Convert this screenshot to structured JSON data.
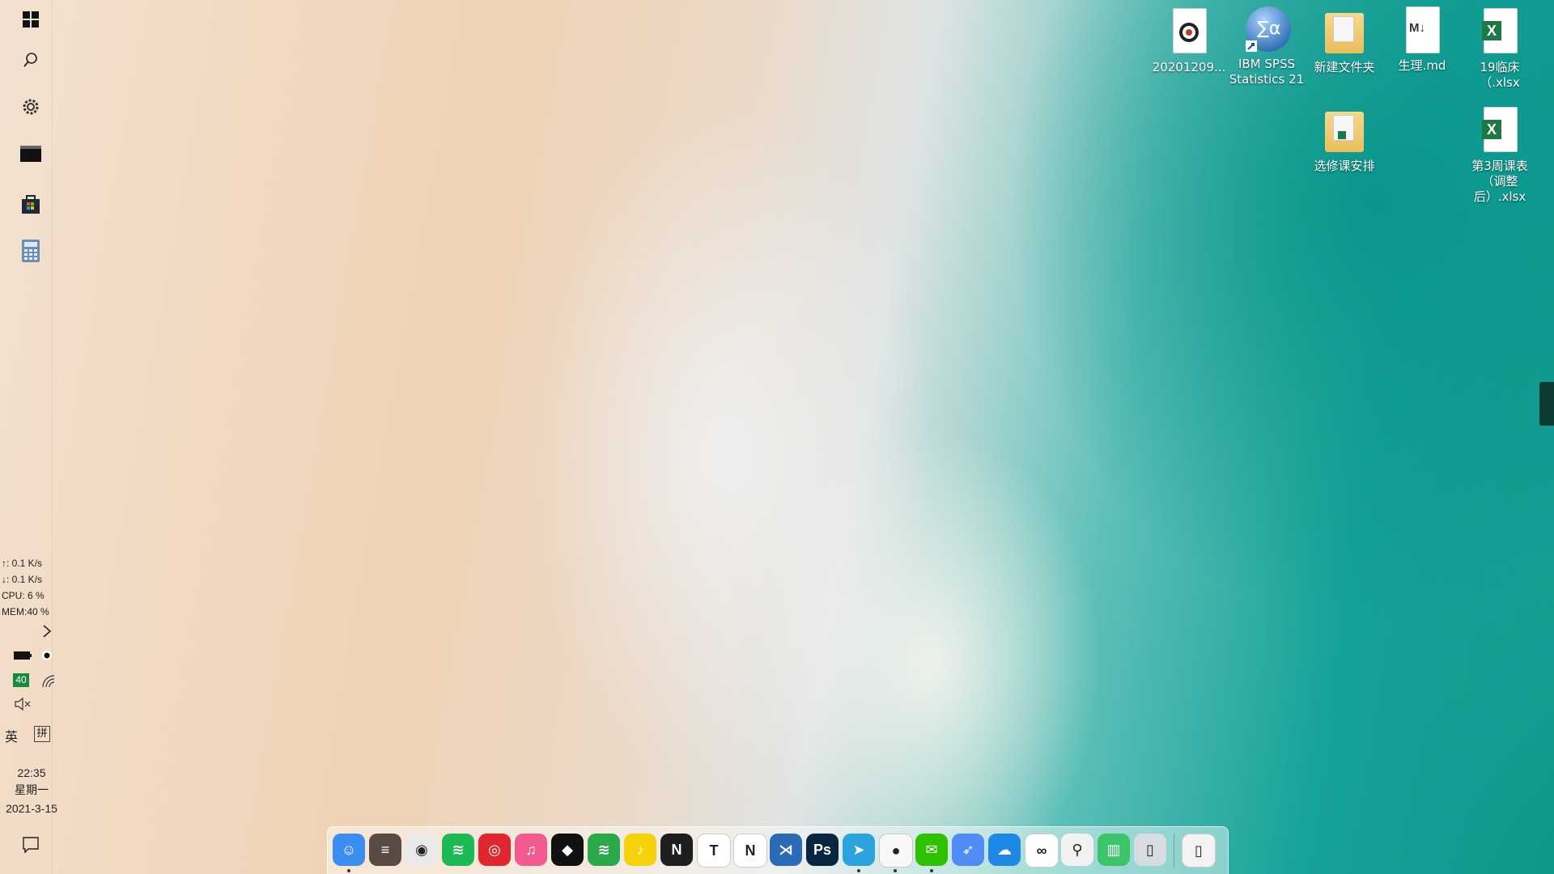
{
  "left_bar": {
    "net_up": "↑: 0.1 K/s",
    "net_down": "↓: 0.1 K/s",
    "cpu": "CPU: 6 %",
    "mem": "MEM:40 %",
    "battery_badge": "40",
    "ime_lang": "英",
    "ime_mode": "拼",
    "time": "22:35",
    "weekday": "星期一",
    "date": "2021-3-15"
  },
  "desktop_icons": [
    {
      "label": "20201209...",
      "icon": "audio-file-icon"
    },
    {
      "label": "IBM SPSS Statistics 21",
      "icon": "spss-icon"
    },
    {
      "label": "新建文件夹",
      "icon": "folder-icon"
    },
    {
      "label": "生理.md",
      "icon": "markdown-file-icon"
    },
    {
      "label": "19临床（.xlsx",
      "icon": "excel-file-icon"
    },
    {
      "label": "选修课安排",
      "icon": "folder-icon"
    },
    {
      "label": "第3周课表（调整后）.xlsx",
      "icon": "excel-file-icon"
    }
  ],
  "dock": {
    "apps": [
      {
        "name": "finder",
        "color": "#3b8df0",
        "glyph": "☺"
      },
      {
        "name": "notes-app",
        "color": "#5a4a44",
        "glyph": "≡"
      },
      {
        "name": "chrome",
        "color": "#e9e9e9",
        "glyph": "◉"
      },
      {
        "name": "spotify",
        "color": "#1db954",
        "glyph": "≋"
      },
      {
        "name": "netease-music",
        "color": "#e0262f",
        "glyph": "◎"
      },
      {
        "name": "itunes",
        "color": "#f05a8c",
        "glyph": "♫"
      },
      {
        "name": "tidal",
        "color": "#111111",
        "glyph": "◆"
      },
      {
        "name": "spotify-alt",
        "color": "#2aa84a",
        "glyph": "≋"
      },
      {
        "name": "qq-music",
        "color": "#f5d20a",
        "glyph": "♪"
      },
      {
        "name": "netflix",
        "color": "#1e1e1e",
        "glyph": "N"
      },
      {
        "name": "typora",
        "color": "#ffffff",
        "glyph": "T"
      },
      {
        "name": "notion",
        "color": "#ffffff",
        "glyph": "N"
      },
      {
        "name": "vscode",
        "color": "#2c6bb6",
        "glyph": "⋊"
      },
      {
        "name": "photoshop",
        "color": "#0a2540",
        "glyph": "Ps"
      },
      {
        "name": "telegram",
        "color": "#2aa3de",
        "glyph": "➤"
      },
      {
        "name": "qq",
        "color": "#f7f7f7",
        "glyph": "●"
      },
      {
        "name": "wechat",
        "color": "#2dc100",
        "glyph": "✉"
      },
      {
        "name": "feishu",
        "color": "#4f8df5",
        "glyph": "➶"
      },
      {
        "name": "onedrive",
        "color": "#1e88e5",
        "glyph": "☁"
      },
      {
        "name": "baidu-netdisk",
        "color": "#ffffff",
        "glyph": "∞"
      },
      {
        "name": "search-tool",
        "color": "#f2f2f2",
        "glyph": "⚲"
      },
      {
        "name": "recycle-bin",
        "color": "#3cc46b",
        "glyph": "▥"
      },
      {
        "name": "trash-can",
        "color": "#d7dce2",
        "glyph": "▯"
      },
      {
        "name": "trash-empty",
        "color": "#f3f3f3",
        "glyph": "▯"
      }
    ]
  }
}
